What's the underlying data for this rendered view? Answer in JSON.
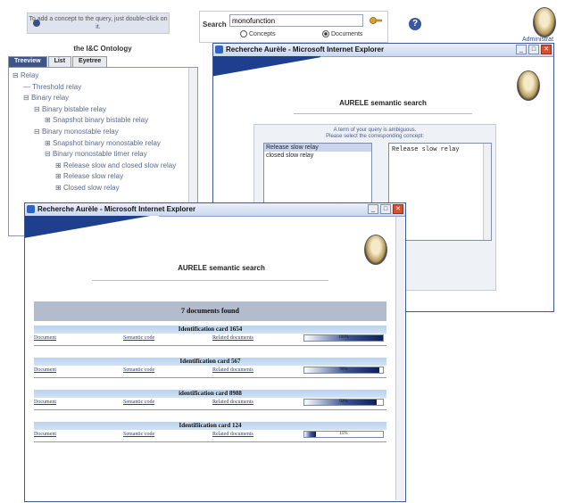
{
  "hint": "To add a concept to the query, just double-click on it.",
  "ontology": {
    "title": "the I&C Ontology",
    "tabs": [
      "Treeview",
      "List",
      "Eyetree"
    ],
    "tree": [
      {
        "label": "Relay",
        "level": 0,
        "expander": "⊟"
      },
      {
        "label": "Threshold relay",
        "level": 1,
        "expander": ""
      },
      {
        "label": "Binary relay",
        "level": 1,
        "expander": "⊟"
      },
      {
        "label": "Binary bistable relay",
        "level": 2,
        "expander": "⊟"
      },
      {
        "label": "Snapshot binary bistable relay",
        "level": 3,
        "expander": "⊞"
      },
      {
        "label": "Binary monostable relay",
        "level": 2,
        "expander": "⊟"
      },
      {
        "label": "Snapshot binary monostable relay",
        "level": 3,
        "expander": "⊞"
      },
      {
        "label": "Binary monostable timer relay",
        "level": 3,
        "expander": "⊟"
      },
      {
        "label": "Release slow and closed slow relay",
        "level": 4,
        "expander": "⊞"
      },
      {
        "label": "Release slow relay",
        "level": 4,
        "expander": "⊞"
      },
      {
        "label": "Closed slow relay",
        "level": 4,
        "expander": "⊞"
      }
    ]
  },
  "search": {
    "label": "Search",
    "value": "monofunction",
    "options": [
      {
        "label": "Concepts",
        "selected": false
      },
      {
        "label": "Documents",
        "selected": true
      }
    ]
  },
  "header": {
    "help": "?",
    "admin_label": "Administrat"
  },
  "win1": {
    "title": "Recherche Aurèle - Microsoft Internet Explorer",
    "heading": "AURELE semantic search",
    "ambiguous_line1": "A term of your query is ambiguous.",
    "ambiguous_line2": "Please select the corresponding concept:",
    "options": [
      "Release slow relay",
      "closed slow relay"
    ],
    "selected_index": 0,
    "detail": "Release slow relay"
  },
  "win2": {
    "title": "Recherche Aurèle - Microsoft Internet Explorer",
    "heading": "AURELE semantic search",
    "found": "7 documents found",
    "link_labels": [
      "Document",
      "Semantic code",
      "Related documents"
    ],
    "cards": [
      {
        "title": "Identification card 1654",
        "score": "100%",
        "fraction": 1.0
      },
      {
        "title": "Identification card 567",
        "score": "96%",
        "fraction": 0.96
      },
      {
        "title": "identification card 8988",
        "score": "92%",
        "fraction": 0.92
      },
      {
        "title": "Identifiication card 124",
        "score": "15%",
        "fraction": 0.15
      }
    ]
  },
  "colors": {
    "accent": "#1d3f8e",
    "tab_active": "#3e5388",
    "card_header": "#b9d2ee"
  }
}
